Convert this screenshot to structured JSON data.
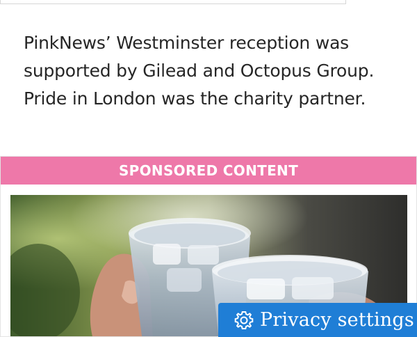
{
  "article": {
    "caption": "PinkNews’ Westminster reception was supported by Gilead and Octopus Group. Pride in London was the charity partner."
  },
  "sponsored": {
    "header_label": "SPONSORED CONTENT",
    "image_description_icon": "photo-two-glasses-toast"
  },
  "privacy": {
    "label": "Privacy settings",
    "icon": "gear-icon"
  },
  "colors": {
    "sponsored_header": "#ee78a9",
    "privacy_button": "#1f7ed6"
  }
}
